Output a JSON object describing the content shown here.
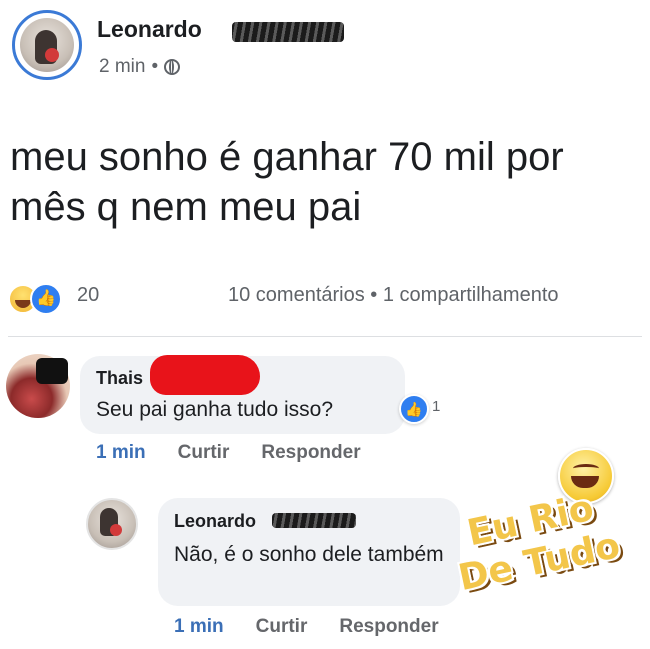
{
  "post": {
    "author": "Leonardo",
    "time": "2 min",
    "separator": "•",
    "privacy_icon": "globe-icon",
    "text": "meu sonho é ganhar 70 mil por mês q nem meu pai",
    "reactions": {
      "icons": [
        "haha-icon",
        "like-icon"
      ],
      "count": "20"
    },
    "stats": "10 comentários • 1 compartilhamento"
  },
  "comments": [
    {
      "author": "Thais",
      "text": "Seu pai ganha tudo isso?",
      "reaction_count": "1",
      "time": "1 min",
      "like_label": "Curtir",
      "reply_label": "Responder"
    },
    {
      "author": "Leonardo",
      "text": "Não, é o sonho dele também",
      "time": "1 min",
      "like_label": "Curtir",
      "reply_label": "Responder"
    }
  ],
  "watermark": {
    "line1": "Eu Rio",
    "line2": "De Tudo"
  },
  "colors": {
    "accent": "#3b6fb6",
    "like_blue": "#2f7ef0",
    "bubble": "#f0f2f5",
    "redaction": "#e8131a"
  }
}
